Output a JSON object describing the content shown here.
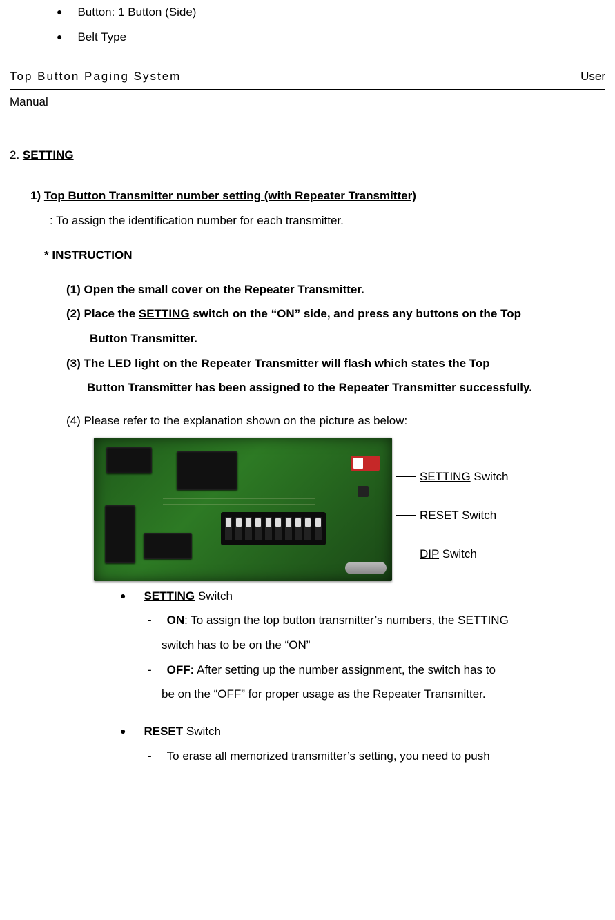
{
  "top_bullets": [
    "Button: 1 Button (Side)",
    "Belt Type"
  ],
  "header": {
    "left": "Top  Button  Paging  System",
    "right": "User",
    "below": "Manual"
  },
  "section": {
    "num": "2. ",
    "title": "SETTING"
  },
  "sub1": {
    "num": "1) ",
    "title": "Top Button Transmitter number setting (with Repeater Transmitter)",
    "desc": ": To assign the identification number for each transmitter."
  },
  "instr_head": {
    "star": "* ",
    "title": "INSTRUCTION"
  },
  "steps": {
    "s1": "(1) Open the small cover on the Repeater Transmitter.",
    "s2a": "(2) Place the ",
    "s2b": "SETTING",
    "s2c": " switch on the “ON” side, and press any buttons on the Top",
    "s2_cont": "Button Transmitter.",
    "s3a": "(3)  The  LED  light  on  the  Repeater  Transmitter  will  flash  which  states  the  Top",
    "s3_cont": "Button Transmitter has been assigned to the Repeater Transmitter successfully.",
    "s4": "(4) Please refer to the explanation shown on the picture as below:"
  },
  "fig_labels": {
    "setting": {
      "u": "SETTING",
      "rest": " Switch"
    },
    "reset": {
      "u": "RESET",
      "rest": " Switch"
    },
    "dip": {
      "u": "DIP",
      "rest": " Switch"
    }
  },
  "detail": {
    "setting_head": {
      "u": "SETTING",
      "rest": " Switch"
    },
    "on_label": "ON",
    "on_a": ": To assign the top button transmitter’s numbers, the ",
    "on_b": "SETTING",
    "on_cont": "switch has to be on the “ON”",
    "off_label": "OFF:",
    "off_a": " After setting up the number assignment, the switch has to",
    "off_cont": "be on the “OFF” for proper usage as the Repeater Transmitter.",
    "reset_head": {
      "u": "RESET",
      "rest": " Switch"
    },
    "reset_a": "To  erase  all  memorized  transmitter’s  setting,  you  need  to  push"
  }
}
